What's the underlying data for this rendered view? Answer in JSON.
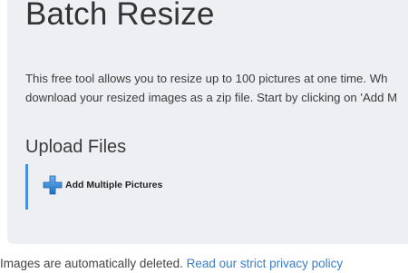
{
  "main": {
    "title": "Batch Resize",
    "description_line1": "This free tool allows you to resize up to 100 pictures at one time. Wh",
    "description_line2": "download your resized images as a zip file. Start by clicking on 'Add M",
    "upload_heading": "Upload Files",
    "add_button_label": "Add Multiple Pictures",
    "add_button_icon": "plus-icon"
  },
  "footer": {
    "text": "Images are automatically deleted. ",
    "privacy_link": "Read our strict privacy policy"
  },
  "colors": {
    "panel_background": "#eeeff2",
    "accent_blue": "#4a90d9",
    "link_blue": "#3b7dc4"
  }
}
